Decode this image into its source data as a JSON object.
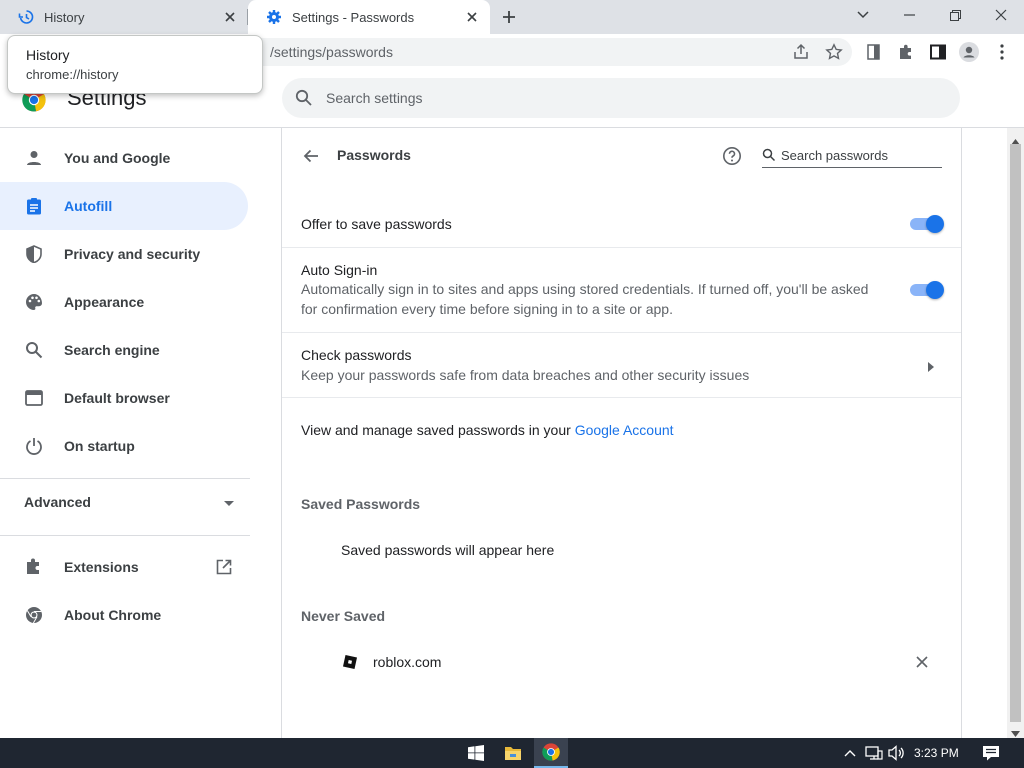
{
  "tabs": [
    {
      "title": "History",
      "icon": "history-icon"
    },
    {
      "title": "Settings - Passwords",
      "icon": "gear-icon",
      "active": true
    }
  ],
  "tooltip": {
    "title": "History",
    "url": "chrome://history"
  },
  "toolbar": {
    "url": "/settings/passwords"
  },
  "header": {
    "title": "Settings",
    "search_placeholder": "Search settings"
  },
  "sidebar": {
    "items": [
      {
        "label": "You and Google",
        "icon": "person-icon"
      },
      {
        "label": "Autofill",
        "icon": "clipboard-icon",
        "active": true
      },
      {
        "label": "Privacy and security",
        "icon": "shield-icon"
      },
      {
        "label": "Appearance",
        "icon": "palette-icon"
      },
      {
        "label": "Search engine",
        "icon": "search-icon"
      },
      {
        "label": "Default browser",
        "icon": "browser-icon"
      },
      {
        "label": "On startup",
        "icon": "power-icon"
      }
    ],
    "advanced_label": "Advanced",
    "extensions_label": "Extensions",
    "about_label": "About Chrome"
  },
  "passwords": {
    "title": "Passwords",
    "search_placeholder": "Search passwords",
    "offer_to_save": {
      "label": "Offer to save passwords",
      "enabled": true
    },
    "auto_signin": {
      "label": "Auto Sign-in",
      "description": "Automatically sign in to sites and apps using stored credentials. If turned off, you'll be asked for confirmation every time before signing in to a site or app.",
      "enabled": true
    },
    "check": {
      "label": "Check passwords",
      "description": "Keep your passwords safe from data breaches and other security issues"
    },
    "manage_text": "View and manage saved passwords in your ",
    "manage_link": "Google Account",
    "saved_title": "Saved Passwords",
    "saved_empty": "Saved passwords will appear here",
    "never_title": "Never Saved",
    "never_saved": [
      {
        "site": "roblox.com"
      }
    ]
  },
  "taskbar": {
    "time": "3:23 PM"
  },
  "colors": {
    "accent": "#1a73e8",
    "active_nav_bg": "#e8f0fe",
    "taskbar": "#1f2631"
  }
}
